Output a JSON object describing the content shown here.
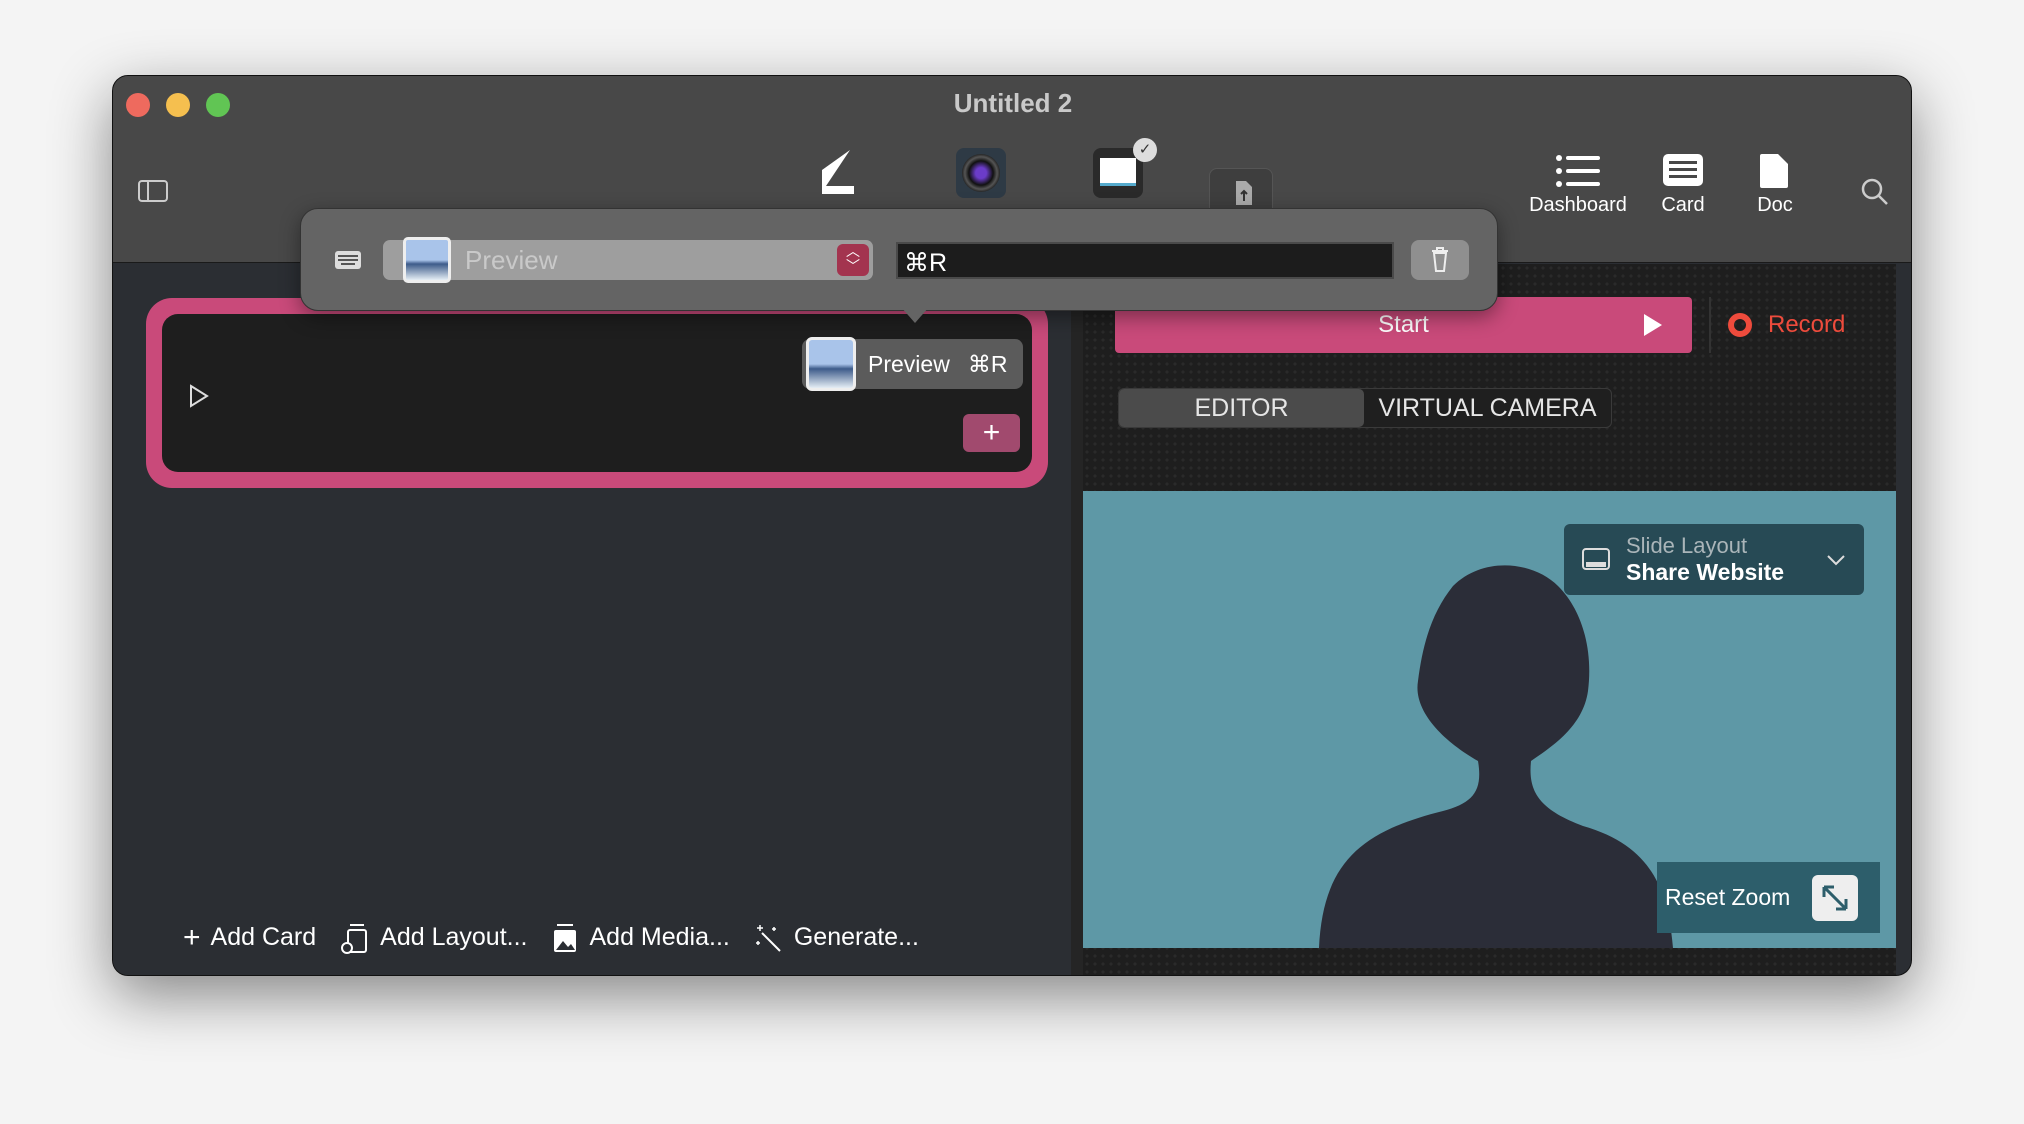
{
  "window": {
    "title": "Untitled 2"
  },
  "toolbar": {
    "items": [
      {
        "label": "Dashboard",
        "icon": "list-icon"
      },
      {
        "label": "Card",
        "icon": "card-icon"
      },
      {
        "label": "Doc",
        "icon": "doc-icon"
      }
    ]
  },
  "popover": {
    "app": "Preview",
    "shortcut": "⌘R"
  },
  "card": {
    "app": "Preview",
    "shortcut": "⌘R"
  },
  "controls": {
    "start": "Start",
    "record": "Record",
    "tabs": [
      "EDITOR",
      "VIRTUAL CAMERA"
    ],
    "active_tab": "EDITOR"
  },
  "video": {
    "slide_layout_label": "Slide Layout",
    "slide_layout_value": "Share Website",
    "reset_zoom": "Reset Zoom"
  },
  "bottom": {
    "add_card": "Add Card",
    "add_layout": "Add Layout...",
    "add_media": "Add Media...",
    "generate": "Generate..."
  },
  "colors": {
    "accent": "#c94a7a",
    "record": "#ee4b3c",
    "video_bg": "#5e98a6"
  }
}
